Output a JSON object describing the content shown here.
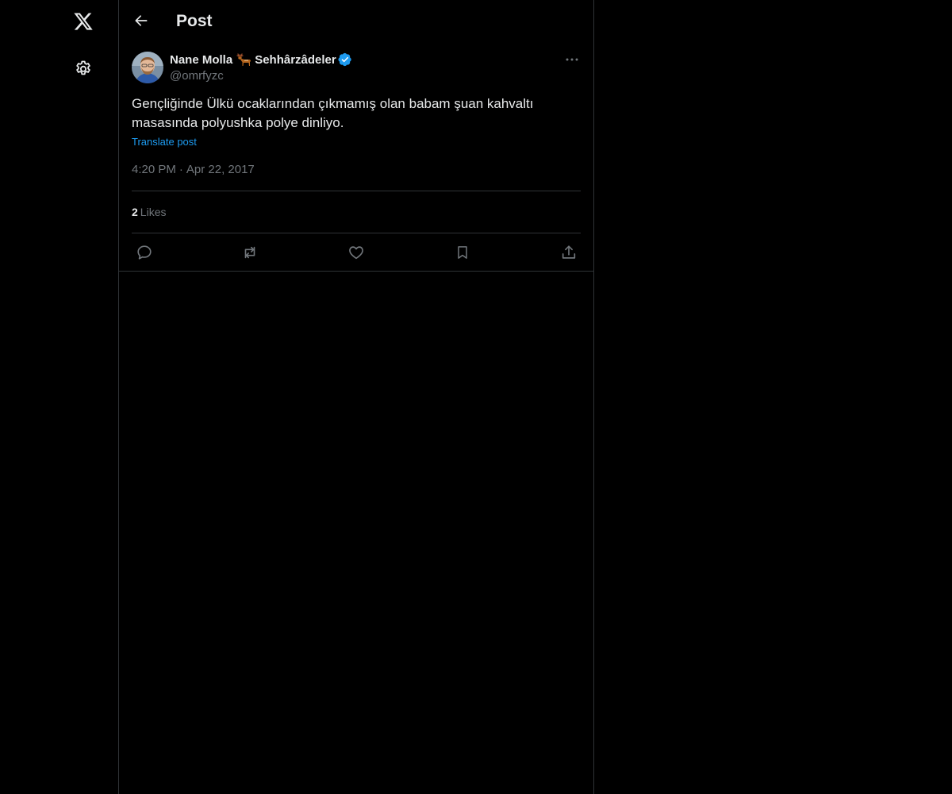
{
  "nav": {
    "logo_icon": "x-logo-icon",
    "settings_icon": "gear-icon"
  },
  "header": {
    "title": "Post",
    "back_icon": "arrow-left-icon"
  },
  "post": {
    "author": {
      "display_name_first": "Nane Molla",
      "display_name_emoji": "deer-emoji-icon",
      "display_name_second": "Sehhârzâdeler",
      "handle": "@omrfyzc",
      "verified": true
    },
    "text": "Gençliğinde Ülkü ocaklarından çıkmamış olan babam şuan kahvaltı masasında polyushka polye dinliyo.",
    "translate_label": "Translate post",
    "time": "4:20 PM",
    "separator": "·",
    "date": "Apr 22, 2017",
    "likes_count": "2",
    "likes_label": "Likes"
  },
  "colors": {
    "background": "#000000",
    "text_primary": "#e7e9ea",
    "text_secondary": "#71767b",
    "accent": "#1d9bf0",
    "border": "#2f3336"
  }
}
